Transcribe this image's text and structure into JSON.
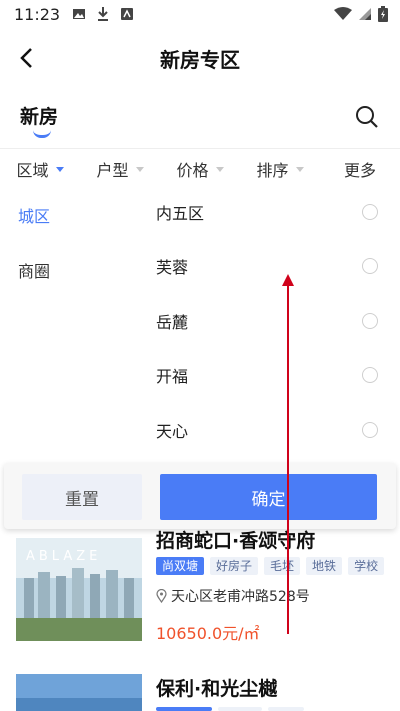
{
  "status_bar": {
    "time": "11:23"
  },
  "header": {
    "title": "新房专区"
  },
  "tabs": {
    "active_label": "新房"
  },
  "filters": [
    {
      "label": "区域",
      "active": true
    },
    {
      "label": "户型",
      "active": false
    },
    {
      "label": "价格",
      "active": false
    },
    {
      "label": "排序",
      "active": false
    },
    {
      "label": "更多",
      "active": false
    }
  ],
  "dropdown": {
    "left_items": [
      {
        "label": "城区",
        "selected": true
      },
      {
        "label": "商圈",
        "selected": false
      }
    ],
    "right_items": [
      {
        "label": "内五区"
      },
      {
        "label": "芙蓉"
      },
      {
        "label": "岳麓"
      },
      {
        "label": "开福"
      },
      {
        "label": "天心"
      }
    ]
  },
  "actions": {
    "reset": "重置",
    "confirm": "确定"
  },
  "listings": [
    {
      "name": "招商蛇口·香颂守府",
      "tags": [
        "尚双塘",
        "好房子",
        "毛坯",
        "地铁",
        "学校"
      ],
      "address": "天心区老甫冲路528号",
      "price": "10650.0元/㎡",
      "image_text": "ABLAZE"
    },
    {
      "name": "保利·和光尘樾",
      "tags": [],
      "address": "",
      "price": ""
    }
  ],
  "colors": {
    "accent": "#4a7cf6",
    "price": "#f0522b",
    "annotation": "#d0021b"
  }
}
